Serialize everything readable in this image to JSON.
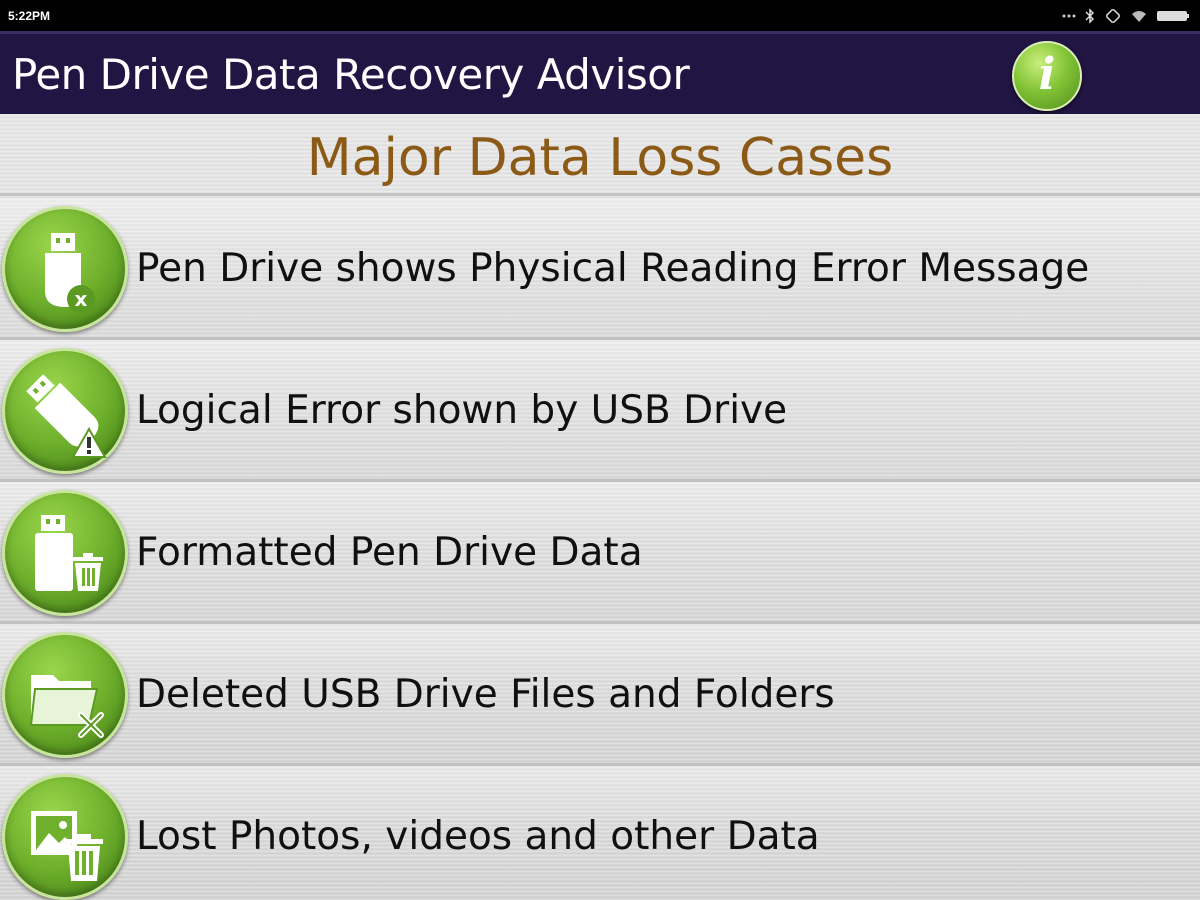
{
  "status_bar": {
    "time": "5:22PM",
    "icons": [
      "more-dots-icon",
      "bluetooth-icon",
      "rotation-icon",
      "wifi-icon",
      "battery-icon"
    ]
  },
  "app_bar": {
    "title": "Pen Drive Data Recovery Advisor",
    "info_icon": "info-icon",
    "info_glyph": "i",
    "background_color": "#211544",
    "accent_green": "#6fb02c"
  },
  "section": {
    "title": "Major Data Loss Cases",
    "title_color": "#8b5a16"
  },
  "cases": [
    {
      "label": "Pen Drive shows Physical Reading Error Message",
      "icon": "usb-error-icon"
    },
    {
      "label": "Logical Error shown by USB Drive",
      "icon": "usb-warning-icon"
    },
    {
      "label": "Formatted Pen Drive Data",
      "icon": "usb-trash-icon"
    },
    {
      "label": "Deleted USB Drive Files and Folders",
      "icon": "folder-delete-icon"
    },
    {
      "label": "Lost Photos, videos and other Data",
      "icon": "photo-trash-icon"
    }
  ]
}
